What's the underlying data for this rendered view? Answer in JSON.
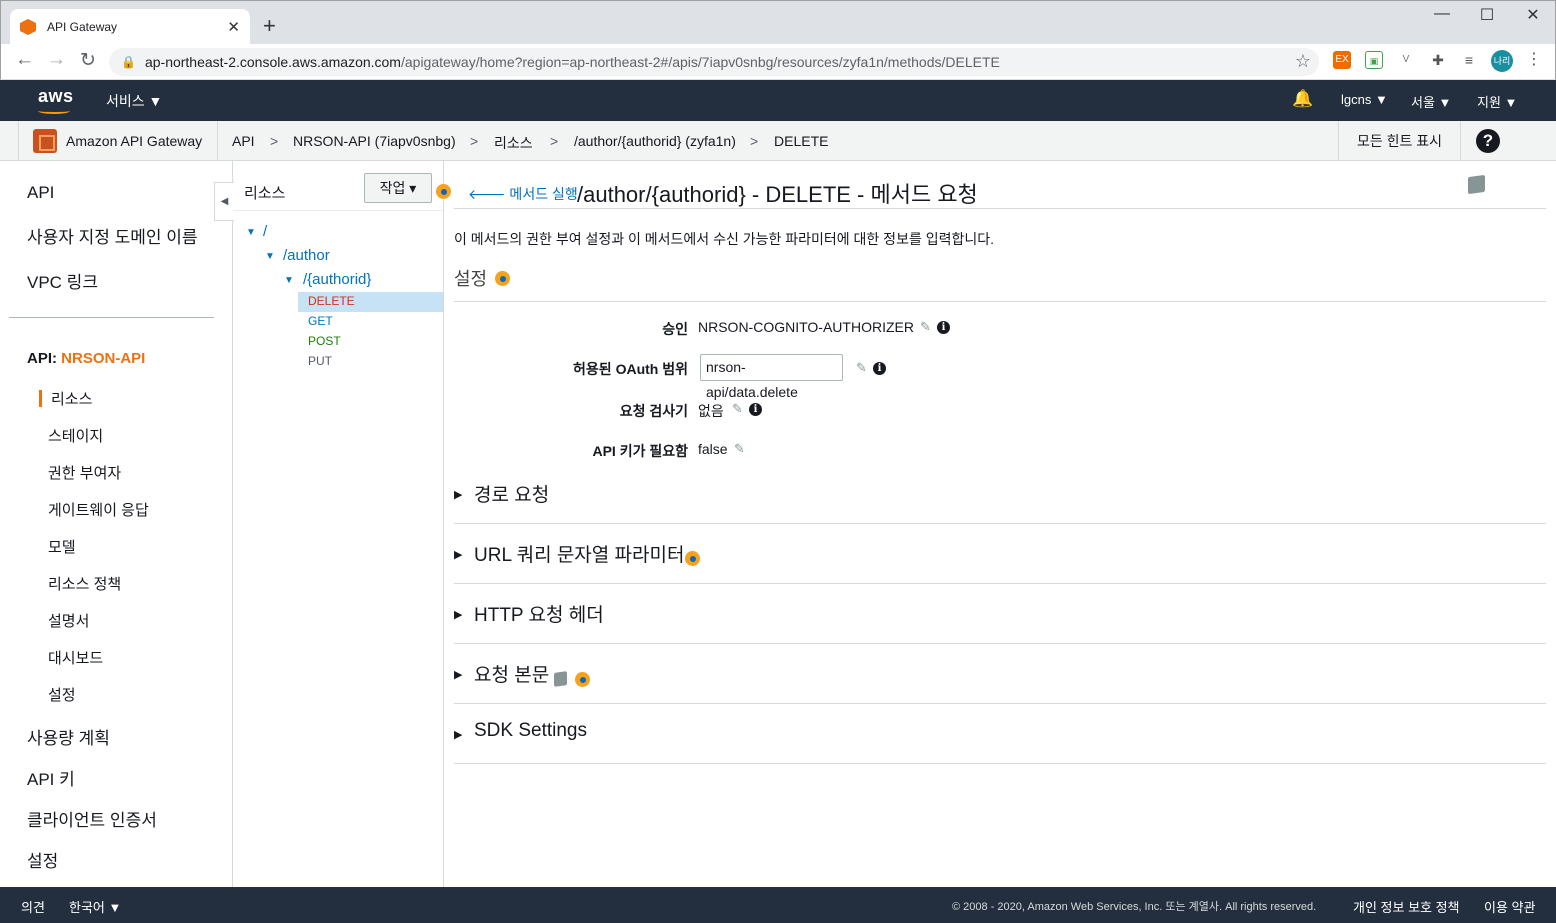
{
  "browser": {
    "tab_title": "API Gateway",
    "tab_close": "✕",
    "new_tab": "+",
    "url_host": "ap-northeast-2.console.aws.amazon.com",
    "url_path": "/apigateway/home?region=ap-northeast-2#/apis/7iapv0snbg/resources/zyfa1n/methods/DELETE",
    "profile_initials": "나리",
    "ext_label": "EX"
  },
  "aws_header": {
    "logo": "aws",
    "services": "서비스 ▼",
    "account": "lgcns ▼",
    "region": "서울 ▼",
    "support": "지원 ▼"
  },
  "breadcrumb": {
    "service": "Amazon API Gateway",
    "items": [
      "API",
      "NRSON-API (7iapv0snbg)",
      "리소스",
      "/author/{authorid} (zyfa1n)",
      "DELETE"
    ],
    "separator": ">",
    "hints_button": "모든 힌트 표시",
    "help": "?"
  },
  "leftnav": {
    "top_items": [
      "API",
      "사용자 지정 도메인 이름",
      "VPC 링크"
    ],
    "api_prefix": "API: ",
    "api_name": "NRSON-API",
    "sub_items": [
      "리소스",
      "스테이지",
      "권한 부여자",
      "게이트웨이 응답",
      "모델",
      "리소스 정책",
      "설명서",
      "대시보드",
      "설정"
    ],
    "bottom_items": [
      "사용량 계획",
      "API 키",
      "클라이언트 인증서",
      "설정"
    ],
    "collapse": "◀"
  },
  "tree": {
    "title": "리소스",
    "actions_button": "작업 ▾",
    "nodes": [
      "/",
      "/author",
      "/{authorid}"
    ],
    "methods": [
      {
        "label": "DELETE",
        "color": "#d13212"
      },
      {
        "label": "GET",
        "color": "#0073bb"
      },
      {
        "label": "POST",
        "color": "#1d8102"
      },
      {
        "label": "PUT",
        "color": "#545b64"
      }
    ]
  },
  "main": {
    "back_link": "🡐 메서드 실행",
    "title": "/author/{authorid} - DELETE - 메서드 요청",
    "description": "이 메서드의 권한 부여 설정과 이 메서드에서 수신 가능한 파라미터에 대한 정보를 입력합니다.",
    "settings_heading": "설정",
    "fields": [
      {
        "label": "승인",
        "value": "NRSON-COGNITO-AUTHORIZER"
      },
      {
        "label": "허용된 OAuth 범위",
        "value": "nrson-api/data.delete"
      },
      {
        "label": "요청 검사기",
        "value": "없음"
      },
      {
        "label": "API 키가 필요함",
        "value": "false"
      }
    ],
    "sections": [
      "경로 요청",
      "URL 쿼리 문자열 파라미터",
      "HTTP 요청 헤더",
      "요청 본문",
      "SDK Settings"
    ]
  },
  "footer": {
    "feedback": "의견",
    "language": "한국어 ▼",
    "copyright": "© 2008 - 2020, Amazon Web Services, Inc. 또는 계열사. All rights reserved.",
    "privacy": "개인 정보 보호 정책",
    "terms": "이용 약관"
  }
}
